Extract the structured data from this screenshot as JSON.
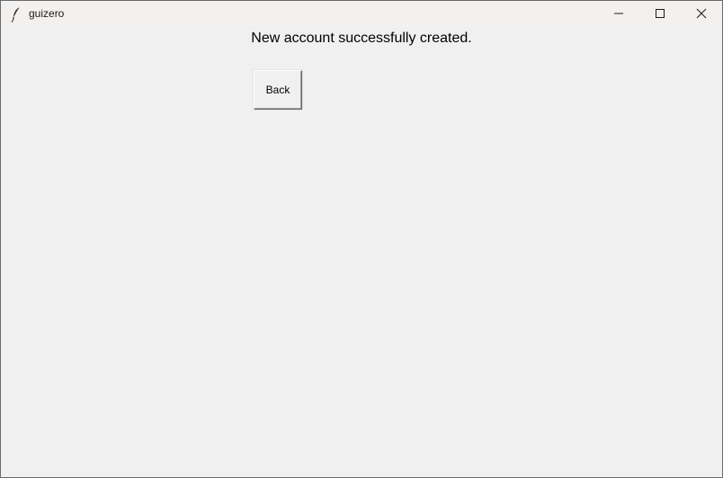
{
  "window": {
    "title": "guizero",
    "controls": {
      "minimize_icon": "minimize-icon",
      "maximize_icon": "maximize-icon",
      "close_icon": "close-icon"
    },
    "app_icon": "feather-icon"
  },
  "main": {
    "message": "New account successfully created.",
    "back_label": "Back"
  },
  "colors": {
    "window_bg": "#f0f0f0",
    "titlebar_bg": "#f3f1ef",
    "text": "#000000"
  }
}
